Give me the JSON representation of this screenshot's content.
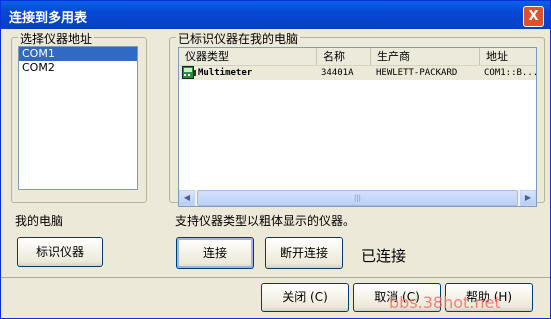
{
  "window": {
    "title": "连接到多用表",
    "close_glyph": "X"
  },
  "address_group": {
    "label": "选择仪器地址",
    "items": [
      "COM1",
      "COM2"
    ],
    "selected_index": 0
  },
  "my_computer_label": "我的电脑",
  "identify_button": "标识仪器",
  "identified_group": {
    "label": "已标识仪器在我的电脑",
    "columns": [
      "仪器类型",
      "名称",
      "生产商",
      "地址"
    ],
    "rows": [
      {
        "type": "Multimeter",
        "name": "34401A",
        "manufacturer": "HEWLETT-PACKARD",
        "address": "COM1::B..."
      }
    ],
    "scroll_left": "◀",
    "scroll_right": "▶",
    "scroll_grip": "|||"
  },
  "hint_text": "支持仪器类型以粗体显示的仪器。",
  "connect_button": "连接",
  "disconnect_button": "断开连接",
  "status_text": "已连接",
  "footer": {
    "close": "关闭 (C)",
    "cancel": "取消 (C)",
    "help": "帮助 (H)"
  },
  "watermark": "bbs.38hot.net",
  "colors": {
    "title_bar": "#0549d6",
    "selection": "#316ac5",
    "watermark": "#ff6a6a"
  }
}
